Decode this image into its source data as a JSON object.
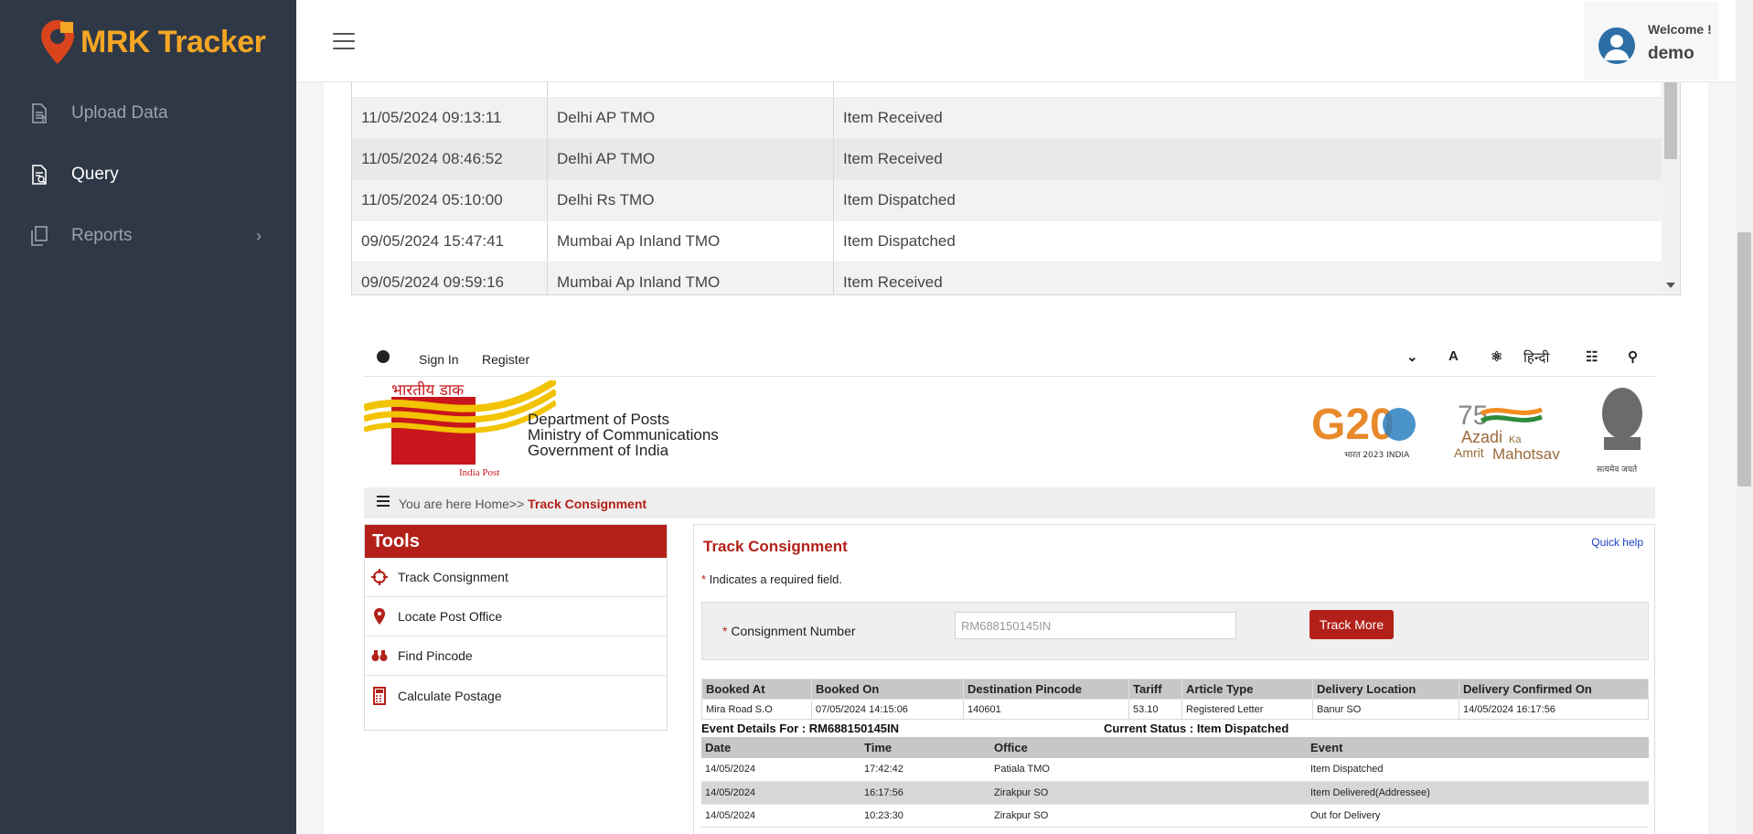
{
  "app": {
    "name": "MRK Tracker"
  },
  "sidebar": {
    "items": [
      {
        "label": "Upload Data",
        "icon": "upload-file-icon",
        "active": false
      },
      {
        "label": "Query",
        "icon": "query-file-icon",
        "active": true
      },
      {
        "label": "Reports",
        "icon": "reports-icon",
        "active": false,
        "has_submenu": true
      }
    ]
  },
  "header": {
    "welcome": "Welcome !",
    "username": "demo"
  },
  "scan_table": {
    "rows": [
      {
        "datetime": "11/05/2024 09:13:11",
        "office": "Delhi AP TMO",
        "event": "Item Received"
      },
      {
        "datetime": "11/05/2024 08:46:52",
        "office": "Delhi AP TMO",
        "event": "Item Received"
      },
      {
        "datetime": "11/05/2024 05:10:00",
        "office": "Delhi Rs TMO",
        "event": "Item Dispatched"
      },
      {
        "datetime": "09/05/2024 15:47:41",
        "office": "Mumbai Ap Inland TMO",
        "event": "Item Dispatched"
      },
      {
        "datetime": "09/05/2024 09:59:16",
        "office": "Mumbai Ap Inland TMO",
        "event": "Item Received"
      }
    ]
  },
  "indiapost": {
    "topbar": {
      "sign_in": "Sign In",
      "register": "Register",
      "hindi": "हिन्दी"
    },
    "brand": {
      "hindi_name": "भारतीय डाक",
      "english_name": "India Post",
      "dept_lines": [
        "Department of Posts",
        "Ministry of Communications",
        "Government of India"
      ]
    },
    "g20": {
      "text": "G20",
      "sub": "भारत 2023 INDIA"
    },
    "azadi": {
      "line1": "Azadi",
      "ka": "Ka",
      "line2": "Amrit",
      "line3": "Mahotsav",
      "num": "75"
    },
    "emblem_motto": "सत्यमेव जयते",
    "breadcrumb": {
      "prefix": "You are here Home>> ",
      "current": "Track Consignment"
    },
    "tools": {
      "title": "Tools",
      "items": [
        {
          "label": "Track Consignment",
          "icon": "crosshair-icon"
        },
        {
          "label": "Locate Post Office",
          "icon": "location-pin-icon"
        },
        {
          "label": "Find Pincode",
          "icon": "binoculars-icon"
        },
        {
          "label": "Calculate Postage",
          "icon": "calculator-icon"
        }
      ]
    },
    "track": {
      "title": "Track Consignment",
      "quick_help": "Quick help",
      "required_note": "Indicates a required field.",
      "cn_label": "Consignment Number",
      "cn_value": "RM688150145IN",
      "track_more": "Track More",
      "booking_headers": [
        "Booked At",
        "Booked On",
        "Destination Pincode",
        "Tariff",
        "Article Type",
        "Delivery Location",
        "Delivery Confirmed On"
      ],
      "booking_row": [
        "Mira Road S.O",
        "07/05/2024 14:15:06",
        "140601",
        "53.10",
        "Registered Letter",
        "Banur SO",
        "14/05/2024 16:17:56"
      ],
      "event_details": "Event Details For : RM688150145IN",
      "current_status": "Current Status : Item Dispatched",
      "event_headers": [
        "Date",
        "Time",
        "Office",
        "Event"
      ],
      "events": [
        [
          "14/05/2024",
          "17:42:42",
          "Patiala TMO",
          "Item Dispatched"
        ],
        [
          "14/05/2024",
          "16:17:56",
          "Zirakpur SO",
          "Item Delivered(Addressee)"
        ],
        [
          "14/05/2024",
          "10:23:30",
          "Zirakpur SO",
          "Out for Delivery"
        ]
      ]
    }
  },
  "colors": {
    "sidebar": "#2f3846",
    "brand_orange": "#f5a623",
    "ip_red": "#b32019"
  }
}
